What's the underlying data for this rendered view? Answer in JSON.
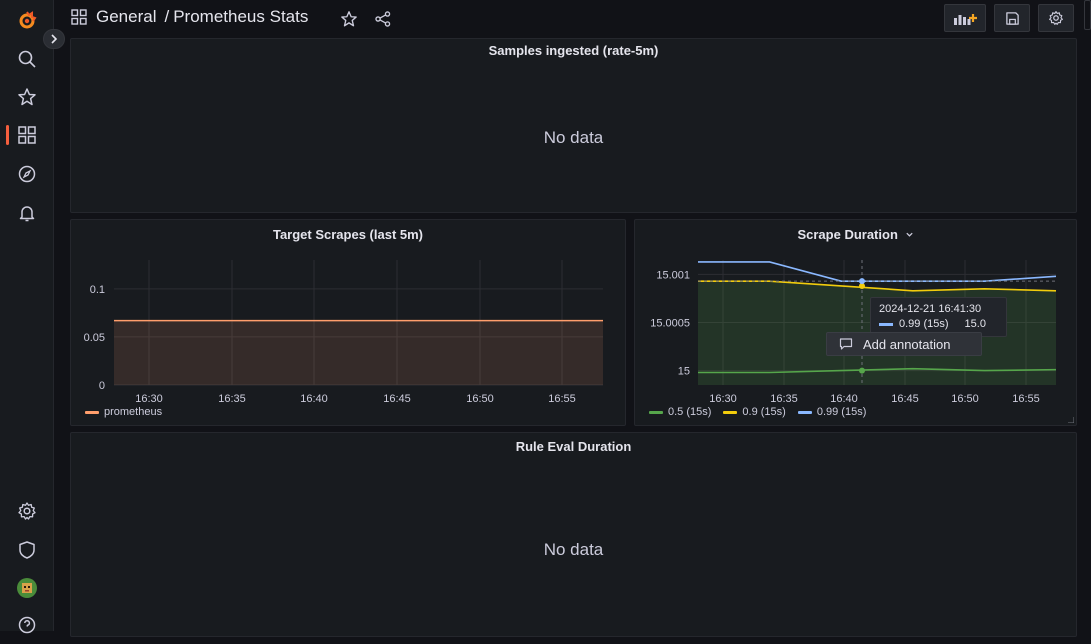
{
  "breadcrumb": {
    "folder": "General",
    "separator": "/",
    "dashboard": "Prometheus Stats"
  },
  "panels": {
    "samples": {
      "title": "Samples ingested (rate-5m)",
      "no_data": "No data"
    },
    "target_scrapes": {
      "title": "Target Scrapes (last 5m)",
      "chart_data": {
        "type": "area",
        "x": [
          "16:30",
          "16:35",
          "16:40",
          "16:45",
          "16:50",
          "16:55"
        ],
        "y_ticks": [
          "0.1",
          "0.05",
          "0"
        ],
        "ylim": [
          0,
          0.13
        ],
        "series": [
          {
            "name": "prometheus",
            "values": [
              0.067,
              0.067,
              0.067,
              0.067,
              0.067,
              0.067
            ],
            "color": "#ff9e6c"
          }
        ]
      },
      "legend": [
        "prometheus"
      ]
    },
    "scrape_duration": {
      "title": "Scrape Duration",
      "chart_data": {
        "type": "line",
        "x": [
          "16:30",
          "16:35",
          "16:40",
          "16:45",
          "16:50",
          "16:55"
        ],
        "y_ticks": [
          "15.001",
          "15.0005",
          "15"
        ],
        "ylim": [
          14.99985,
          15.00115
        ],
        "series": [
          {
            "name": "0.5 (15s)",
            "color": "#56a64b",
            "values": [
              14.99998,
              14.99998,
              15.0,
              15.00002,
              15.0,
              15.00001
            ]
          },
          {
            "name": "0.9 (15s)",
            "color": "#f2cc0c",
            "values": [
              15.00093,
              15.00093,
              15.00088,
              15.00083,
              15.00085,
              15.00083
            ]
          },
          {
            "name": "0.99 (15s)",
            "color": "#8ab8ff",
            "values": [
              15.00113,
              15.00113,
              15.00093,
              15.00093,
              15.00093,
              15.00098
            ]
          }
        ]
      },
      "legend": [
        "0.5 (15s)",
        "0.9 (15s)",
        "0.99 (15s)"
      ],
      "tooltip": {
        "time": "2024-12-21 16:41:30",
        "series": "0.99 (15s)",
        "value": "15.0"
      },
      "context_menu": {
        "add_annotation": "Add annotation"
      }
    },
    "rule_eval": {
      "title": "Rule Eval Duration",
      "no_data": "No data"
    }
  },
  "icons": {
    "logo": "grafana-logo",
    "search": "search-icon",
    "starred": "star-icon",
    "dashboards": "dashboards-icon",
    "explore": "compass-icon",
    "alerting": "bell-icon",
    "config": "gear-icon",
    "admin": "shield-icon",
    "profile": "avatar",
    "help": "help-icon"
  },
  "colors": {
    "accent": "#f55f3e",
    "panel_bg": "#181b1f",
    "page_bg": "#111217"
  }
}
